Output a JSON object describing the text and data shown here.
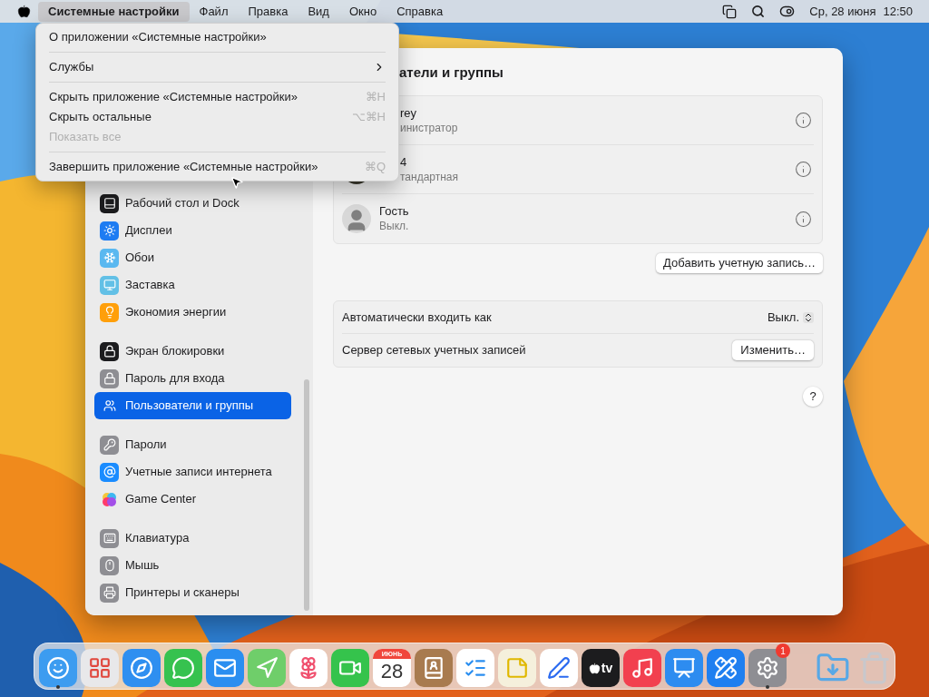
{
  "menu_bar": {
    "items": [
      {
        "label": "Системные настройки",
        "selected": true
      },
      {
        "label": "Файл",
        "selected": false
      },
      {
        "label": "Правка",
        "selected": false
      },
      {
        "label": "Вид",
        "selected": false
      },
      {
        "label": "Окно",
        "selected": false
      },
      {
        "label": "Справка",
        "selected": false
      }
    ],
    "date": "Ср, 28 июня",
    "time": "12:50"
  },
  "app_menu": {
    "items": [
      {
        "kind": "item",
        "label": "О приложении «Системные настройки»",
        "disabled": false
      },
      {
        "kind": "separator"
      },
      {
        "kind": "submenu",
        "label": "Службы",
        "disabled": false
      },
      {
        "kind": "separator"
      },
      {
        "kind": "item",
        "label": "Скрыть приложение «Системные настройки»",
        "shortcut": "⌘H",
        "disabled": false
      },
      {
        "kind": "item",
        "label": "Скрыть остальные",
        "shortcut": "⌥⌘H",
        "disabled": false
      },
      {
        "kind": "item",
        "label": "Показать все",
        "disabled": true
      },
      {
        "kind": "separator"
      },
      {
        "kind": "item",
        "label": "Завершить приложение «Системные настройки»",
        "shortcut": "⌘Q",
        "disabled": false
      }
    ]
  },
  "window": {
    "title": "атели и группы",
    "sidebar": {
      "groups": [
        {
          "items": [
            {
              "label": "Рабочий стол и Dock",
              "selected": false
            },
            {
              "label": "Дисплеи",
              "selected": false
            },
            {
              "label": "Обои",
              "selected": false
            },
            {
              "label": "Заставка",
              "selected": false
            },
            {
              "label": "Экономия энергии",
              "selected": false
            }
          ]
        },
        {
          "items": [
            {
              "label": "Экран блокировки",
              "selected": false
            },
            {
              "label": "Пароль для входа",
              "selected": false
            },
            {
              "label": "Пользователи и группы",
              "selected": true
            }
          ]
        },
        {
          "items": [
            {
              "label": "Пароли",
              "selected": false
            },
            {
              "label": "Учетные записи интернета",
              "selected": false
            },
            {
              "label": "Game Center",
              "selected": false
            }
          ]
        },
        {
          "items": [
            {
              "label": "Клавиатура",
              "selected": false
            },
            {
              "label": "Мышь",
              "selected": false
            },
            {
              "label": "Принтеры и сканеры",
              "selected": false
            }
          ]
        }
      ]
    },
    "users": [
      {
        "kind": "covered",
        "name": "rey",
        "role": "инистратор"
      },
      {
        "name": "4",
        "role": "тандартная"
      },
      {
        "kind": "guest",
        "name": "Гость",
        "role": "Выкл."
      }
    ],
    "add_account_button": "Добавить учетную запись…",
    "settings": [
      {
        "kind": "popup",
        "label": "Автоматически входить как",
        "value": "Выкл."
      },
      {
        "kind": "button",
        "label": "Сервер сетевых учетных записей",
        "value": "Изменить…"
      }
    ],
    "help_button": "?"
  },
  "dock": {
    "items": [
      {
        "kind": "app",
        "running": true
      },
      {
        "kind": "app",
        "running": false
      },
      {
        "kind": "app",
        "running": false
      },
      {
        "kind": "app",
        "running": false
      },
      {
        "kind": "app",
        "running": false
      },
      {
        "kind": "app",
        "running": false
      },
      {
        "kind": "app",
        "running": false
      },
      {
        "kind": "app",
        "running": false
      },
      {
        "kind": "calendar",
        "month": "ИЮНЬ",
        "day": "28",
        "running": false
      },
      {
        "kind": "app",
        "running": false
      },
      {
        "kind": "app",
        "running": false
      },
      {
        "kind": "app",
        "running": false
      },
      {
        "kind": "app",
        "running": false
      },
      {
        "kind": "tv",
        "label": "tv",
        "running": false
      },
      {
        "kind": "app",
        "running": false
      },
      {
        "kind": "app",
        "running": false
      },
      {
        "kind": "app",
        "running": false
      },
      {
        "kind": "app",
        "badge": "1",
        "running": true
      },
      {
        "kind": "separator"
      },
      {
        "kind": "app",
        "running": false
      },
      {
        "kind": "app",
        "running": false
      }
    ]
  }
}
